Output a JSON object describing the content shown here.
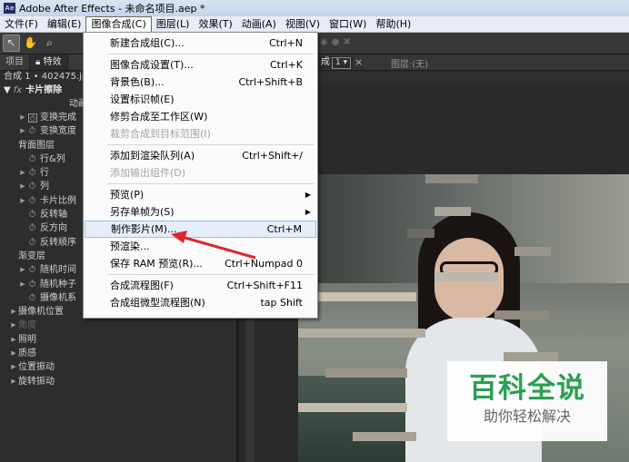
{
  "window": {
    "title": "Adobe After Effects - 未命名项目.aep *",
    "logo_text": "Ae"
  },
  "menubar": [
    {
      "label": "文件(F)"
    },
    {
      "label": "编辑(E)"
    },
    {
      "label": "图像合成(C)",
      "active": true
    },
    {
      "label": "图层(L)"
    },
    {
      "label": "效果(T)"
    },
    {
      "label": "动画(A)"
    },
    {
      "label": "视图(V)"
    },
    {
      "label": "窗口(W)"
    },
    {
      "label": "帮助(H)"
    }
  ],
  "toolbar": {
    "icons": [
      "selection-arrow-icon",
      "hand-icon",
      "zoom-icon"
    ]
  },
  "left_panel": {
    "tabs": [
      "项目",
      "特效"
    ],
    "comp_crumb": "合成 1 • 402475.jp",
    "effect_name": "卡片擦除",
    "effect_sub": "动画",
    "properties": [
      {
        "label": "变换完成",
        "arrow": true,
        "boxed": true
      },
      {
        "label": "变换宽度",
        "arrow": true
      },
      {
        "label": "背面图层",
        "arrow": false,
        "nosw": true
      },
      {
        "label": "行&列",
        "arrow": false
      },
      {
        "label": "行",
        "arrow": true
      },
      {
        "label": "列",
        "arrow": true
      },
      {
        "label": "卡片比例",
        "arrow": true
      },
      {
        "label": "反转轴",
        "arrow": false
      },
      {
        "label": "反方向",
        "arrow": false
      },
      {
        "label": "反转顺序",
        "arrow": false
      },
      {
        "label": "渐变层",
        "arrow": false,
        "nosw": true
      },
      {
        "label": "随机时间",
        "arrow": true
      },
      {
        "label": "随机种子",
        "arrow": true
      },
      {
        "label": "摄像机系",
        "arrow": false
      },
      {
        "label": "摄像机位置",
        "arrow": true,
        "nosw": true
      },
      {
        "label": "角度",
        "arrow": true,
        "nosw": true,
        "disabled": true
      },
      {
        "label": "照明",
        "arrow": true,
        "nosw": true
      },
      {
        "label": "质感",
        "arrow": true,
        "nosw": true
      },
      {
        "label": "位置振动",
        "arrow": true,
        "nosw": true
      },
      {
        "label": "旋转振动",
        "arrow": true,
        "nosw": true
      }
    ]
  },
  "right_panel": {
    "comp_tab": "成",
    "comp_dropdown": "1",
    "layer_label": "图层:(无)"
  },
  "dropdown": {
    "items": [
      {
        "label": "新建合成组(C)...",
        "shortcut": "Ctrl+N"
      },
      {
        "sep": true
      },
      {
        "label": "图像合成设置(T)...",
        "shortcut": "Ctrl+K"
      },
      {
        "label": "背景色(B)...",
        "shortcut": "Ctrl+Shift+B"
      },
      {
        "label": "设置标识帧(E)"
      },
      {
        "label": "修剪合成至工作区(W)"
      },
      {
        "label": "裁剪合成到目标范围(I)",
        "disabled": true
      },
      {
        "sep": true
      },
      {
        "label": "添加到渲染队列(A)",
        "shortcut": "Ctrl+Shift+/"
      },
      {
        "label": "添加输出组件(D)",
        "disabled": true
      },
      {
        "sep": true
      },
      {
        "label": "预览(P)",
        "submenu": true
      },
      {
        "label": "另存单帧为(S)",
        "submenu": true
      },
      {
        "label": "制作影片(M)...",
        "shortcut": "Ctrl+M",
        "highlighted": true
      },
      {
        "label": "预渲染..."
      },
      {
        "label": "保存 RAM 预览(R)...",
        "shortcut": "Ctrl+Numpad 0"
      },
      {
        "sep": true
      },
      {
        "label": "合成流程图(F)",
        "shortcut": "Ctrl+Shift+F11"
      },
      {
        "label": "合成组微型流程图(N)",
        "shortcut": "tap Shift"
      }
    ]
  },
  "watermark": {
    "title": "百科全说",
    "subtitle": "助你轻松解决"
  },
  "colors": {
    "accent_arrow": "#e0252b",
    "watermark_green": "#2aa052",
    "menu_highlight": "#e6eefa"
  }
}
